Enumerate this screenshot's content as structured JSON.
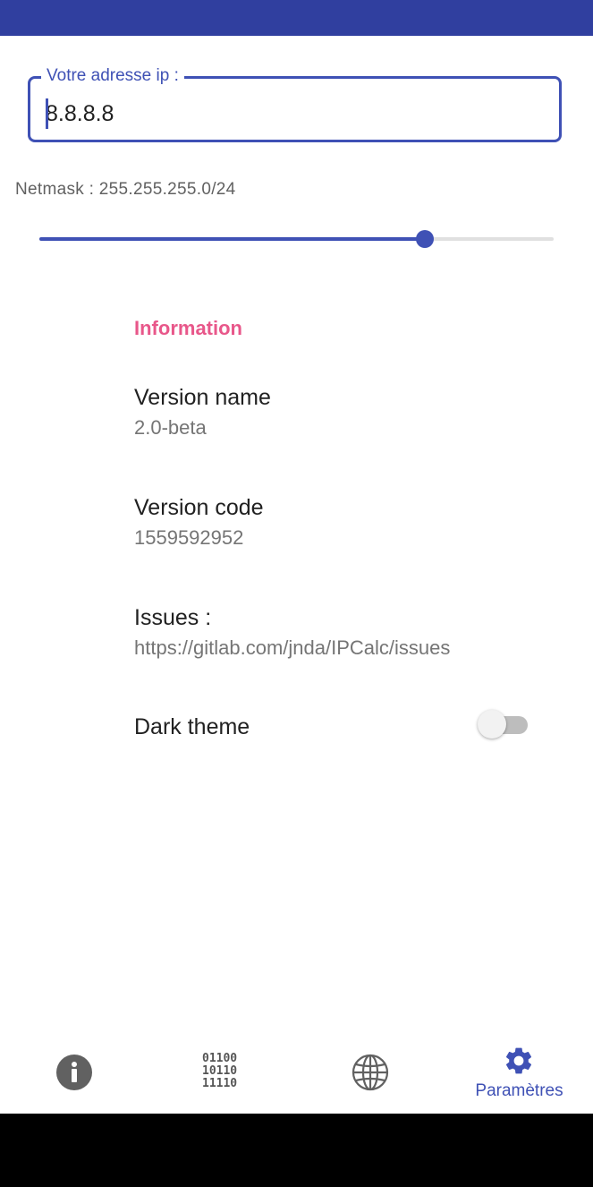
{
  "ip_field": {
    "label": "Votre adresse ip :",
    "value": "8.8.8.8"
  },
  "netmask": {
    "text": "Netmask : 255.255.255.0/24",
    "prefix": 24,
    "slider_fraction": 0.75
  },
  "preferences": {
    "section_title": "Information",
    "items": [
      {
        "title": "Version name",
        "summary": "2.0-beta"
      },
      {
        "title": "Version code",
        "summary": "1559592952"
      },
      {
        "title": "Issues :",
        "summary": "https://gitlab.com/jnda/IPCalc/issues"
      }
    ],
    "dark_theme": {
      "title": "Dark theme",
      "enabled": false
    }
  },
  "bottom_nav": {
    "items": [
      {
        "icon": "info-icon"
      },
      {
        "icon": "binary-icon",
        "bits": [
          "01100",
          "10110",
          "11110"
        ]
      },
      {
        "icon": "globe-icon"
      },
      {
        "icon": "gear-icon",
        "label": "Paramètres",
        "selected": true
      }
    ],
    "accent": "#3f51b5"
  },
  "colors": {
    "primary_dark": "#303f9f",
    "primary": "#3f51b5",
    "accent": "#e8578a"
  }
}
